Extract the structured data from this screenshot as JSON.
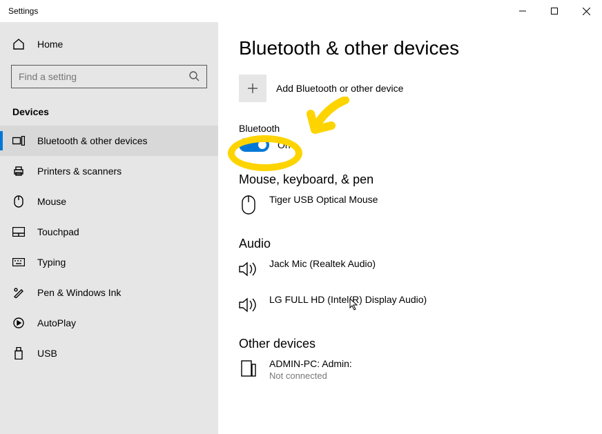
{
  "window": {
    "title": "Settings"
  },
  "sidebar": {
    "home_label": "Home",
    "search_placeholder": "Find a setting",
    "section_label": "Devices",
    "items": [
      {
        "label": "Bluetooth & other devices",
        "name": "nav-bluetooth"
      },
      {
        "label": "Printers & scanners",
        "name": "nav-printers"
      },
      {
        "label": "Mouse",
        "name": "nav-mouse"
      },
      {
        "label": "Touchpad",
        "name": "nav-touchpad"
      },
      {
        "label": "Typing",
        "name": "nav-typing"
      },
      {
        "label": "Pen & Windows Ink",
        "name": "nav-pen"
      },
      {
        "label": "AutoPlay",
        "name": "nav-autoplay"
      },
      {
        "label": "USB",
        "name": "nav-usb"
      }
    ]
  },
  "content": {
    "title": "Bluetooth & other devices",
    "add_label": "Add Bluetooth or other device",
    "bluetooth_label": "Bluetooth",
    "toggle_status": "On",
    "groups": [
      {
        "heading": "Mouse, keyboard, & pen",
        "devices": [
          {
            "name": "Tiger USB Optical Mouse",
            "sub": "",
            "icon": "mouse"
          }
        ]
      },
      {
        "heading": "Audio",
        "devices": [
          {
            "name": "Jack Mic (Realtek Audio)",
            "sub": "",
            "icon": "speaker"
          },
          {
            "name": "LG FULL HD (Intel(R) Display Audio)",
            "sub": "",
            "icon": "speaker"
          }
        ]
      },
      {
        "heading": "Other devices",
        "devices": [
          {
            "name": "ADMIN-PC: Admin:",
            "sub": "Not connected",
            "icon": "pc"
          }
        ]
      }
    ]
  }
}
